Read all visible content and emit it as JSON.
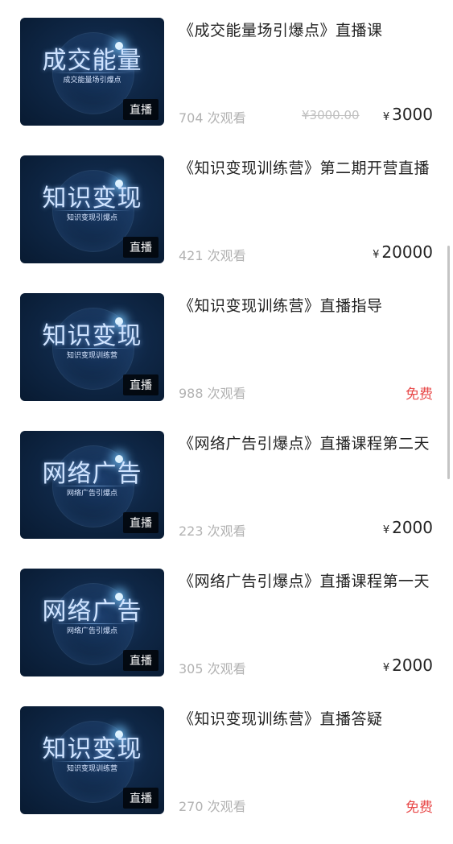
{
  "courses": [
    {
      "thumb_big": "成交能量",
      "thumb_sub": "成交能量场引爆点",
      "tag": "直播",
      "title": "《成交能量场引爆点》直播课",
      "views": "704 次观看",
      "original_price": "¥3000.00",
      "currency": "¥",
      "price": "3000"
    },
    {
      "thumb_big": "知识变现",
      "thumb_sub": "知识变现引爆点",
      "tag": "直播",
      "title": "《知识变现训练营》第二期开营直播",
      "views": "421 次观看",
      "currency": "¥",
      "price": "20000"
    },
    {
      "thumb_big": "知识变现",
      "thumb_sub": "知识变现训练营",
      "tag": "直播",
      "title": "《知识变现训练营》直播指导",
      "views": "988 次观看",
      "price": "免费"
    },
    {
      "thumb_big": "网络广告",
      "thumb_sub": "网络广告引爆点",
      "tag": "直播",
      "title": "《网络广告引爆点》直播课程第二天",
      "views": "223 次观看",
      "currency": "¥",
      "price": "2000"
    },
    {
      "thumb_big": "网络广告",
      "thumb_sub": "网络广告引爆点",
      "tag": "直播",
      "title": "《网络广告引爆点》直播课程第一天",
      "views": "305 次观看",
      "currency": "¥",
      "price": "2000"
    },
    {
      "thumb_big": "知识变现",
      "thumb_sub": "知识变现训练营",
      "tag": "直播",
      "title": "《知识变现训练营》直播答疑",
      "views": "270 次观看",
      "price": "免费"
    }
  ],
  "colors": {
    "free_price": "#e84a4a",
    "tag_bg": "#000000",
    "thumb_bg": "#0f2746"
  }
}
